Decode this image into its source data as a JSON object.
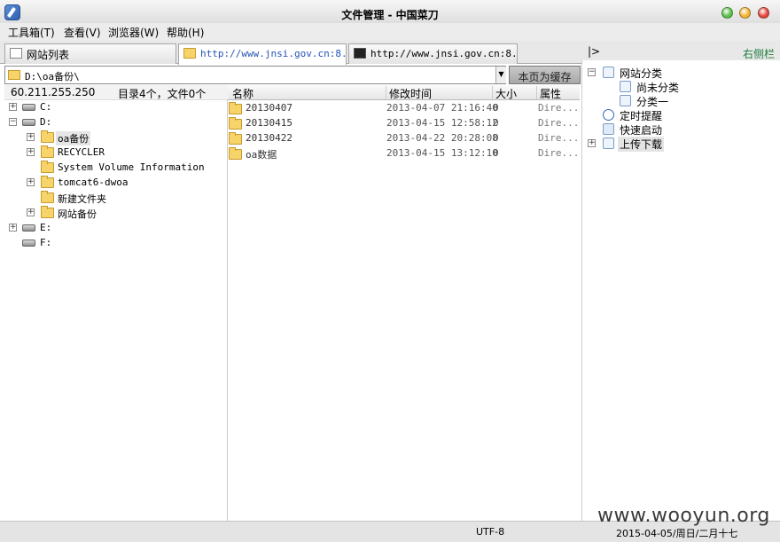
{
  "window": {
    "title": "文件管理 - 中国菜刀",
    "controls": [
      {
        "name": "maximize",
        "color": "#5cbf4a"
      },
      {
        "name": "minimize",
        "color": "#f2b233"
      },
      {
        "name": "close",
        "color": "#e2453c"
      }
    ]
  },
  "menu": {
    "items": [
      "工具箱(T)",
      "查看(V)",
      "浏览器(W)",
      "帮助(H)"
    ]
  },
  "tabs": [
    {
      "label": "网站列表",
      "icon": "page-icon"
    },
    {
      "label": "http://www.jnsi.gov.cn:8...",
      "icon": "folder-icon",
      "active": true
    },
    {
      "label": "http://www.jnsi.gov.cn:8...",
      "icon": "console-icon"
    }
  ],
  "panel_toggle": "|>",
  "right_sidebar_label": "右侧栏",
  "path": {
    "value": "D:\\oa备份\\",
    "cache_button": "本页为缓存"
  },
  "info": {
    "server_ip": "60.211.255.250",
    "summary": "目录4个，文件0个"
  },
  "tree": [
    {
      "label": "C:",
      "type": "drive",
      "expander": "+",
      "depth": 0
    },
    {
      "label": "D:",
      "type": "drive",
      "expander": "−",
      "depth": 0
    },
    {
      "label": "oa备份",
      "type": "folder",
      "expander": "+",
      "depth": 1,
      "selected": true
    },
    {
      "label": "RECYCLER",
      "type": "folder",
      "expander": "+",
      "depth": 1
    },
    {
      "label": "System Volume Information",
      "type": "folder",
      "expander": "",
      "depth": 1
    },
    {
      "label": "tomcat6-dwoa",
      "type": "folder",
      "expander": "+",
      "depth": 1
    },
    {
      "label": "新建文件夹",
      "type": "folder",
      "expander": "",
      "depth": 1
    },
    {
      "label": "网站备份",
      "type": "folder",
      "expander": "+",
      "depth": 1
    },
    {
      "label": "E:",
      "type": "drive",
      "expander": "+",
      "depth": 0
    },
    {
      "label": "F:",
      "type": "drive",
      "expander": "",
      "depth": 0
    }
  ],
  "list": {
    "columns": [
      "名称",
      "修改时间",
      "大小",
      "属性"
    ],
    "rows": [
      {
        "name": "20130407",
        "mtime": "2013-04-07 21:16:40",
        "size": "0",
        "attr": "Dire..."
      },
      {
        "name": "20130415",
        "mtime": "2013-04-15 12:58:12",
        "size": "0",
        "attr": "Dire..."
      },
      {
        "name": "20130422",
        "mtime": "2013-04-22 20:28:08",
        "size": "0",
        "attr": "Dire..."
      },
      {
        "name": "oa数据",
        "mtime": "2013-04-15 13:12:10",
        "size": "0",
        "attr": "Dire..."
      }
    ]
  },
  "right_panel": [
    {
      "label": "网站分类",
      "expander": "−",
      "depth": 0,
      "icon": "category-icon"
    },
    {
      "label": "尚未分类",
      "expander": "",
      "depth": 1,
      "icon": "category-icon"
    },
    {
      "label": "分类一",
      "expander": "",
      "depth": 1,
      "icon": "category-icon"
    },
    {
      "label": "定时提醒",
      "expander": "",
      "depth": 0,
      "icon": "clock-icon"
    },
    {
      "label": "快速启动",
      "expander": "",
      "depth": 0,
      "icon": "hand-icon"
    },
    {
      "label": "上传下载",
      "expander": "+",
      "depth": 0,
      "icon": "category-icon",
      "highlight": true
    }
  ],
  "status": {
    "encoding": "UTF-8",
    "datetime": "2015-04-05/周日/二月十七"
  },
  "watermark": "www.wooyun.org"
}
